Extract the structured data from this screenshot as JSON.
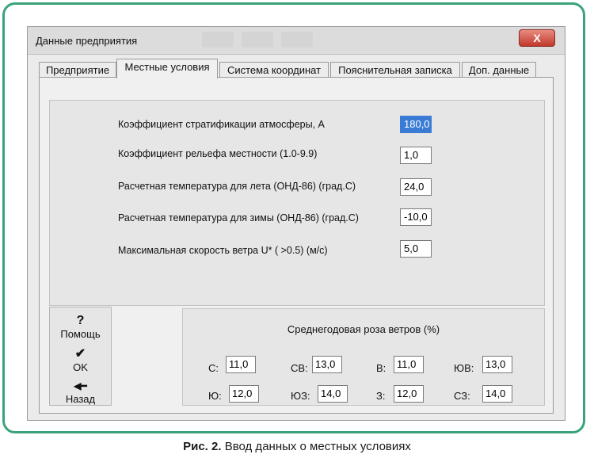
{
  "window": {
    "title": "Данные предприятия",
    "close_label": "X"
  },
  "tabs": [
    {
      "label": "Предприятие"
    },
    {
      "label": "Местные условия"
    },
    {
      "label": "Система координат"
    },
    {
      "label": "Пояснительная записка"
    },
    {
      "label": "Доп. данные"
    }
  ],
  "active_tab": "Местные условия",
  "params": [
    {
      "label": "Коэффициент стратификации атмосферы, А",
      "value": "180,0"
    },
    {
      "label": "Коэффициент рельефа местности (1.0-9.9)",
      "value": "1,0"
    },
    {
      "label": "Расчетная температура для лета (ОНД-86) (град.С)",
      "value": "24,0"
    },
    {
      "label": "Расчетная температура для зимы (ОНД-86) (град.С)",
      "value": "-10,0"
    },
    {
      "label": "Максимальная скорость ветра U* ( >0.5)  (м/с)",
      "value": "5,0"
    }
  ],
  "nav": {
    "help": {
      "icon": "?",
      "label": "Помощь"
    },
    "ok": {
      "icon": "✔",
      "label": "OK"
    },
    "back": {
      "icon": "◀━",
      "label": "Назад"
    }
  },
  "wind_rose": {
    "title": "Среднегодовая роза ветров (%)",
    "items": [
      {
        "label": "С:",
        "value": "11,0"
      },
      {
        "label": "СВ:",
        "value": "13,0"
      },
      {
        "label": "В:",
        "value": "11,0"
      },
      {
        "label": "ЮВ:",
        "value": "13,0"
      },
      {
        "label": "Ю:",
        "value": "12,0"
      },
      {
        "label": "ЮЗ:",
        "value": "14,0"
      },
      {
        "label": "З:",
        "value": "12,0"
      },
      {
        "label": "СЗ:",
        "value": "14,0"
      }
    ]
  },
  "caption": {
    "bold": "Рис. 2.",
    "text": " Ввод данных о местных условиях"
  },
  "colors": {
    "frame": "#3aa37a",
    "selection": "#3a7bd5",
    "close": "#c1392b"
  }
}
